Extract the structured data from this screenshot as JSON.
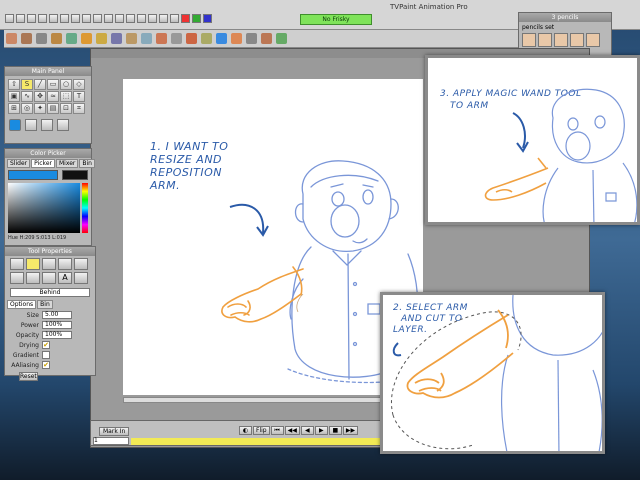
{
  "app": {
    "title": "TVPaint Animation Pro"
  },
  "topbar": {
    "status_label": "No Frisky"
  },
  "panels": {
    "main": {
      "title": "Main Panel"
    },
    "color": {
      "title": "Color Picker",
      "tabs": [
        "Slider",
        "Picker",
        "Mixer",
        "Bin"
      ],
      "readout": "Hue H:209 S:013 L:019"
    },
    "tool": {
      "title": "Tool Properties",
      "blend_mode": "Behind",
      "tabs": [
        "Options",
        "Bin"
      ],
      "fields": [
        {
          "label": "Size",
          "value": "5.00"
        },
        {
          "label": "Power",
          "value": "100%"
        },
        {
          "label": "Opacity",
          "value": "100%"
        }
      ],
      "checks": [
        {
          "label": "Drying"
        },
        {
          "label": "Gradient"
        },
        {
          "label": "AAliasing"
        }
      ],
      "reset_label": "Reset"
    },
    "pencils": {
      "title": "3 pencils",
      "subtitle": "pencils set"
    }
  },
  "timeline": {
    "mark_in_label": "Mark In",
    "frame_value": "1",
    "flip_label": "Flip"
  },
  "notes": {
    "step1": [
      "1. I WANT TO",
      "RESIZE AND",
      "REPOSITION",
      "ARM."
    ],
    "step2": [
      "2. SELECT ARM",
      "AND CUT TO",
      "LAYER."
    ],
    "step3": [
      "3. APPLY MAGIC WAND TOOL",
      "TO ARM"
    ]
  },
  "colors": {
    "sketch_blue": "#7a96d8",
    "arm_orange": "#f0a040",
    "note_blue": "#2a5aa8",
    "status_green": "#7fe35a",
    "timeline_yellow": "#f2ea55"
  }
}
